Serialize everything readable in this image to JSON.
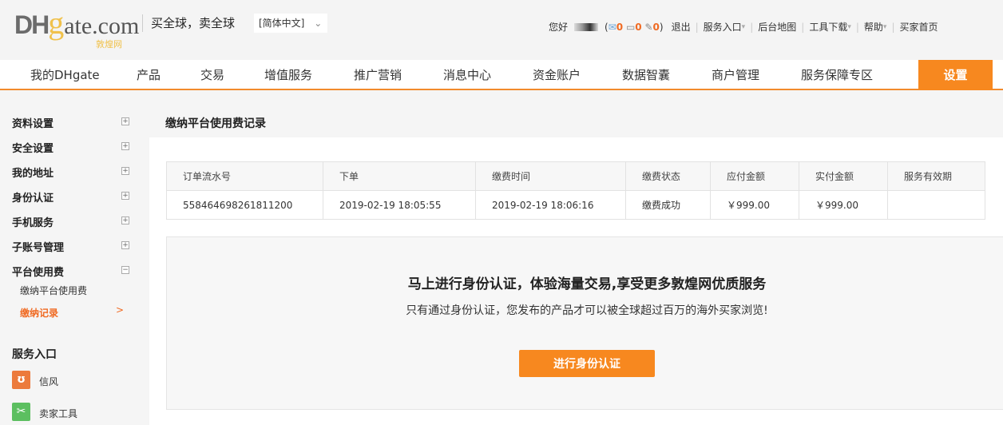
{
  "header": {
    "logo_text": "DHgate.com",
    "logo_cn": "敦煌网",
    "slogan": "买全球，卖全球",
    "language": "[简体中文]",
    "greeting": "您好",
    "mail_count": "0",
    "message_count": "0",
    "notice_count": "0",
    "links": [
      "退出",
      "服务入口",
      "后台地图",
      "工具下载",
      "帮助",
      "买家首页"
    ]
  },
  "nav": {
    "items": [
      "我的DHgate",
      "产品",
      "交易",
      "增值服务",
      "推广营销",
      "消息中心",
      "资金账户",
      "数据智囊",
      "商户管理",
      "服务保障专区"
    ],
    "active": "设置"
  },
  "sidebar": {
    "items": [
      "资料设置",
      "安全设置",
      "我的地址",
      "身份认证",
      "手机服务",
      "子账号管理",
      "平台使用费"
    ],
    "subitems": [
      "缴纳平台使用费",
      "缴纳记录"
    ],
    "current_arrow": ">",
    "services_title": "服务入口",
    "services": [
      "信风",
      "卖家工具"
    ]
  },
  "main": {
    "title": "缴纳平台使用费记录",
    "table": {
      "headers": [
        "订单流水号",
        "下单",
        "缴费时间",
        "缴费状态",
        "应付金额",
        "实付金额",
        "服务有效期"
      ],
      "rows": [
        [
          "558464698261811200",
          "2019-02-19 18:05:55",
          "2019-02-19 18:06:16",
          "缴费成功",
          "￥999.00",
          "￥999.00",
          ""
        ]
      ]
    },
    "promo": {
      "title": "马上进行身份认证，体验海量交易,享受更多敦煌网优质服务",
      "text": "只有通过身份认证，您发布的产品才可以被全球超过百万的海外买家浏览!",
      "button": "进行身份认证"
    }
  },
  "colors": {
    "accent": "#f7881f"
  }
}
